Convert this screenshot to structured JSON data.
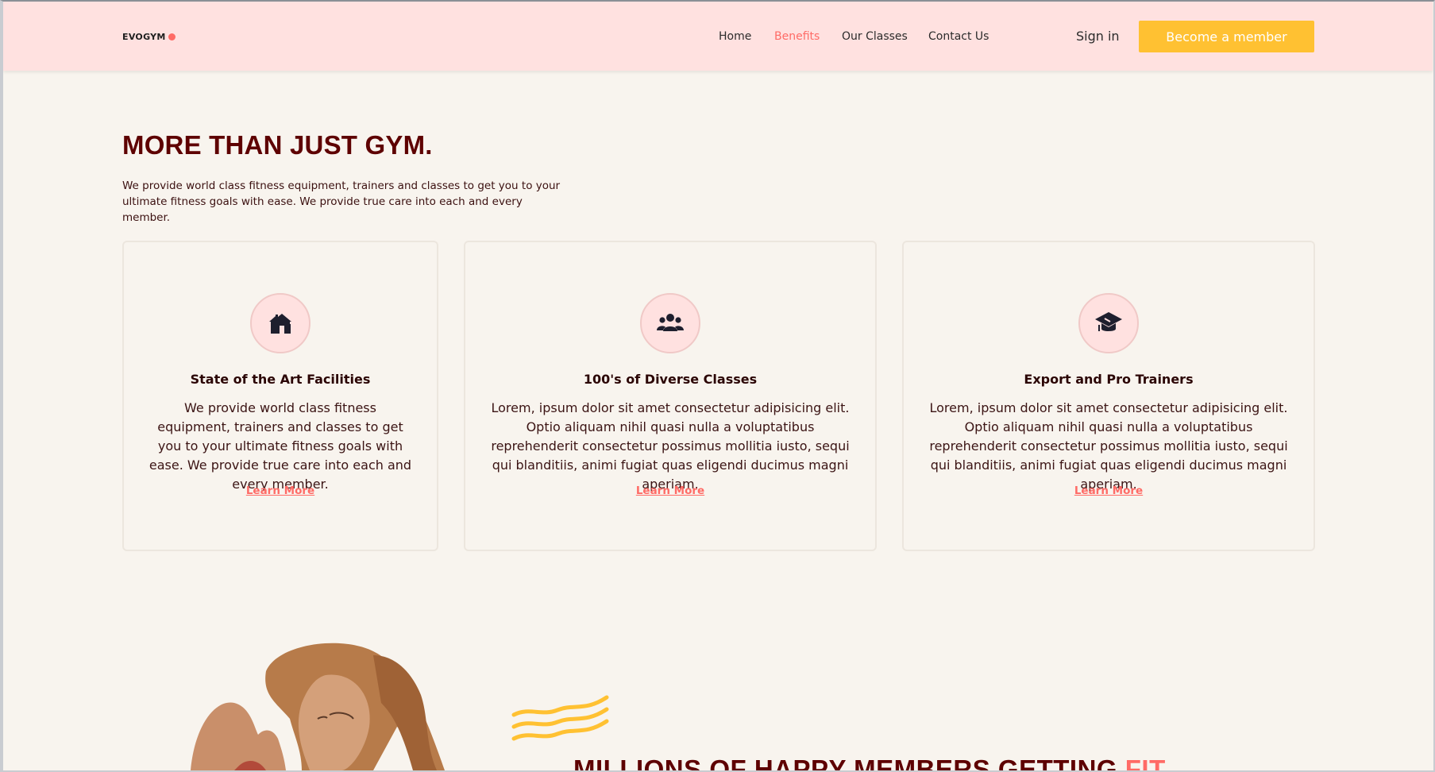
{
  "navbar": {
    "logo_text": "EVOGYM",
    "links": [
      {
        "label": "Home",
        "active": false
      },
      {
        "label": "Benefits",
        "active": true
      },
      {
        "label": "Our Classes",
        "active": false
      },
      {
        "label": "Contact Us",
        "active": false
      }
    ],
    "sign_in": "Sign in",
    "cta": "Become a member"
  },
  "benefits": {
    "heading": "MORE THAN JUST GYM.",
    "intro": "We provide world class fitness equipment, trainers and classes to get you to your ultimate fitness goals with ease. We provide true care into each and every member.",
    "cards": [
      {
        "icon": "home-icon",
        "title": "State of the Art Facilities",
        "body": "We provide world class fitness equipment, trainers and classes to get you to your ultimate fitness goals with ease. We provide true care into each and every member.",
        "link": "Learn More"
      },
      {
        "icon": "users-icon",
        "title": "100's of Diverse Classes",
        "body": "Lorem, ipsum dolor sit amet consectetur adipisicing elit. Optio aliquam nihil quasi nulla a voluptatibus reprehenderit consectetur possimus mollitia iusto, sequi qui blanditiis, animi fugiat quas eligendi ducimus magni aperiam.",
        "link": "Learn More"
      },
      {
        "icon": "graduation-cap-icon",
        "title": "Export and Pro Trainers",
        "body": "Lorem, ipsum dolor sit amet consectetur adipisicing elit. Optio aliquam nihil quasi nulla a voluptatibus reprehenderit consectetur possimus mollitia iusto, sequi qui blanditiis, animi fugiat quas eligendi ducimus magni aperiam.",
        "link": "Learn More"
      }
    ]
  },
  "promo": {
    "heading_prefix": "MILLIONS OF HAPPY MEMBERS GETTING ",
    "heading_highlight": "FIT"
  },
  "colors": {
    "nav_bg": "#ffe1e0",
    "page_bg": "#f8f4ee",
    "primary": "#5e0000",
    "accent": "#ff6b66",
    "cta": "#ffc132"
  }
}
